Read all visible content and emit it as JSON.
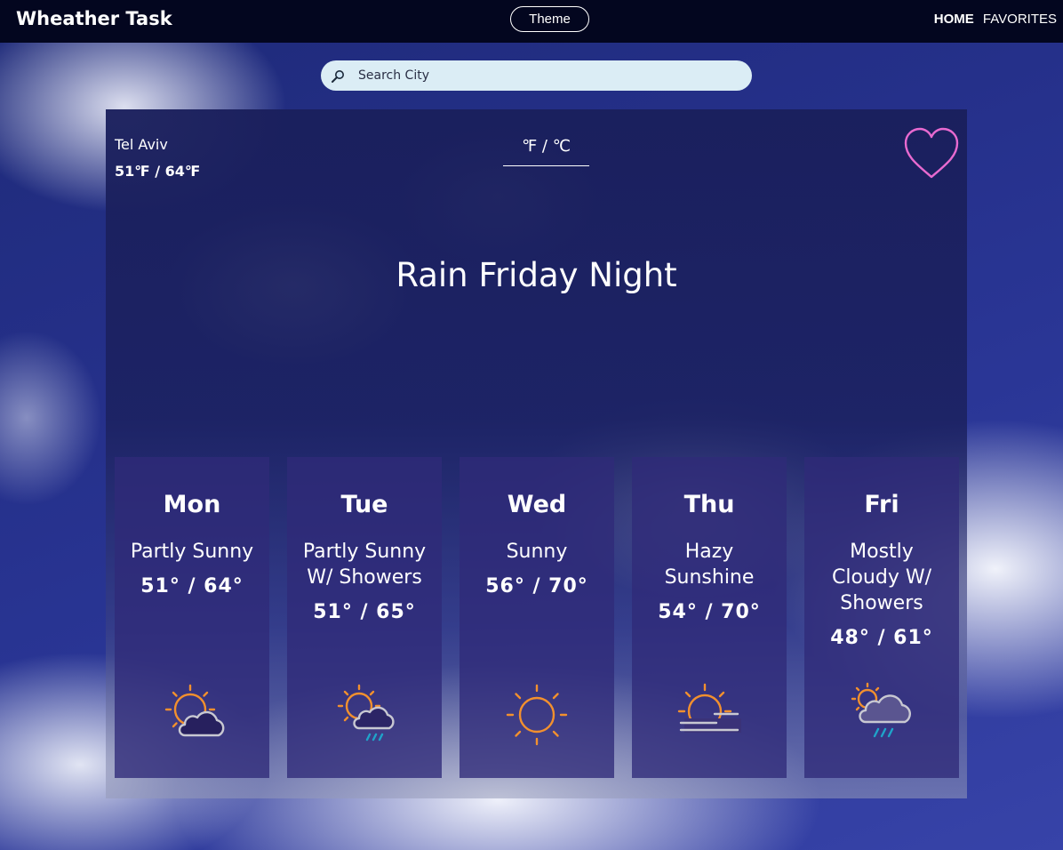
{
  "header": {
    "brand": "Wheather Task",
    "theme_label": "Theme",
    "nav": {
      "home": "HOME",
      "favorites": "FAVORITES"
    }
  },
  "search": {
    "placeholder": "Search City",
    "value": ""
  },
  "current": {
    "city": "Tel Aviv",
    "range": "51℉ / 64℉",
    "unit_toggle": "℉ / ℃",
    "headline": "Rain Friday Night"
  },
  "colors": {
    "heart": "#e86ad0",
    "sun": "#f2902e",
    "cloud": "#c8c8d2",
    "rain": "#1fa3c9"
  },
  "forecast": [
    {
      "day": "Mon",
      "condition": "Partly Sunny",
      "temps": "51° / 64°",
      "icon": "partly-sunny-icon"
    },
    {
      "day": "Tue",
      "condition": "Partly Sunny W/ Showers",
      "temps": "51° / 65°",
      "icon": "partly-sunny-showers-icon"
    },
    {
      "day": "Wed",
      "condition": "Sunny",
      "temps": "56° / 70°",
      "icon": "sunny-icon"
    },
    {
      "day": "Thu",
      "condition": "Hazy Sunshine",
      "temps": "54° / 70°",
      "icon": "hazy-sunshine-icon"
    },
    {
      "day": "Fri",
      "condition": "Mostly Cloudy W/ Showers",
      "temps": "48° / 61°",
      "icon": "mostly-cloudy-showers-icon"
    }
  ]
}
